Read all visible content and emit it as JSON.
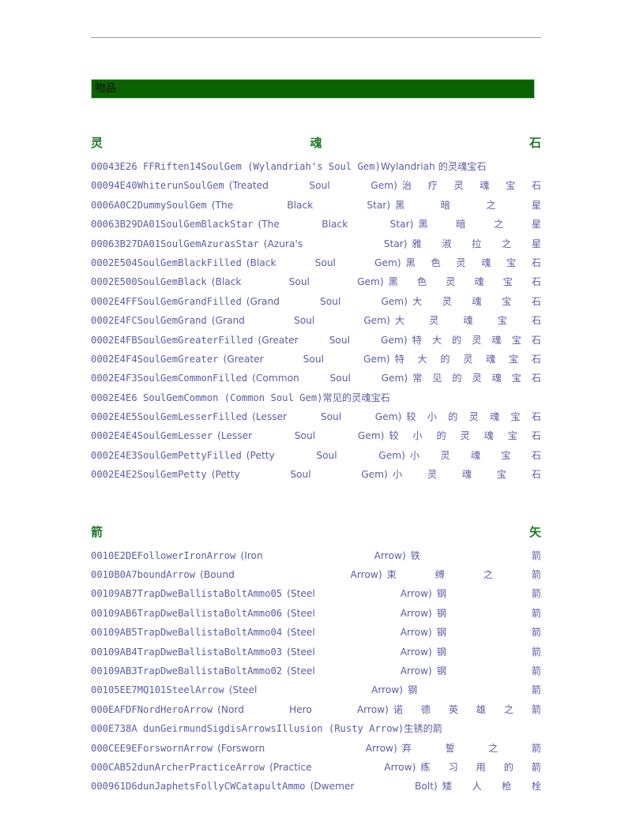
{
  "document": {
    "banner_label": "物品",
    "colors": {
      "banner_bg": "#0a6200",
      "banner_text": "#111111",
      "heading": "#1c7a24",
      "body_text": "#5c5ca8",
      "rule": "#9a9a9a"
    }
  },
  "sections": [
    {
      "heading": "灵魂石",
      "heading_chars": [
        "灵",
        "魂",
        "石"
      ],
      "rows": [
        {
          "id": "00043E26",
          "edid": "FFRiften14SoulGem",
          "en": "(Wylandriah's Soul Gem)",
          "zh": "Wylandriah 的灵魂宝石",
          "justified": false
        },
        {
          "id": "00094E40",
          "edid": "WhiterunSoulGem",
          "en": "(Treated Soul Gem)",
          "zh": "治疗灵魂宝石",
          "justified": true
        },
        {
          "id": "0006A0C2",
          "edid": "DummySoulGem",
          "en": "(The Black Star)",
          "zh": "黑暗之星",
          "justified": true
        },
        {
          "id": "00063B29",
          "edid": "DA01SoulGemBlackStar",
          "en": "(The Black Star)",
          "zh": "黑暗之星",
          "justified": true
        },
        {
          "id": "00063B27",
          "edid": "DA01SoulGemAzurasStar",
          "en": "(Azura's Star)",
          "zh": "雅淑拉之星",
          "justified": true
        },
        {
          "id": "0002E504",
          "edid": "SoulGemBlackFilled",
          "en": "(Black Soul Gem)",
          "zh": "黑色灵魂宝石",
          "justified": true
        },
        {
          "id": "0002E500",
          "edid": "SoulGemBlack",
          "en": "(Black Soul Gem)",
          "zh": "黑色灵魂宝石",
          "justified": true
        },
        {
          "id": "0002E4FF",
          "edid": "SoulGemGrandFilled",
          "en": "(Grand Soul Gem)",
          "zh": "大灵魂宝石",
          "justified": true
        },
        {
          "id": "0002E4FC",
          "edid": "SoulGemGrand",
          "en": "(Grand Soul Gem)",
          "zh": "大灵魂宝石",
          "justified": true
        },
        {
          "id": "0002E4FB",
          "edid": "SoulGemGreaterFilled",
          "en": "(Greater Soul Gem)",
          "zh": "特大的灵魂宝石",
          "justified": true
        },
        {
          "id": "0002E4F4",
          "edid": "SoulGemGreater",
          "en": "(Greater Soul Gem)",
          "zh": "特大的灵魂宝石",
          "justified": true
        },
        {
          "id": "0002E4F3",
          "edid": "SoulGemCommonFilled",
          "en": "(Common Soul Gem)",
          "zh": "常见的灵魂宝石",
          "justified": true
        },
        {
          "id": "0002E4E6",
          "edid": "SoulGemCommon",
          "en": "(Common Soul Gem)",
          "zh": "常见的灵魂宝石",
          "justified": false
        },
        {
          "id": "0002E4E5",
          "edid": "SoulGemLesserFilled",
          "en": "(Lesser Soul Gem)",
          "zh": "较小的灵魂宝石",
          "justified": true
        },
        {
          "id": "0002E4E4",
          "edid": "SoulGemLesser",
          "en": "(Lesser Soul Gem)",
          "zh": "较小的灵魂宝石",
          "justified": true
        },
        {
          "id": "0002E4E3",
          "edid": "SoulGemPettyFilled",
          "en": "(Petty Soul Gem)",
          "zh": "小灵魂宝石",
          "justified": true
        },
        {
          "id": "0002E4E2",
          "edid": "SoulGemPetty",
          "en": "(Petty Soul Gem)",
          "zh": "小灵魂宝石",
          "justified": true
        }
      ]
    },
    {
      "heading": "箭矢",
      "heading_chars": [
        "箭",
        "矢"
      ],
      "rows": [
        {
          "id": "0010E2DE",
          "edid": "FollowerIronArrow",
          "en": "(Iron Arrow)",
          "zh": "铁箭",
          "justified": true
        },
        {
          "id": "0010B0A7",
          "edid": "boundArrow",
          "en": "(Bound Arrow)",
          "zh": "束缚之箭",
          "justified": true
        },
        {
          "id": "00109AB7",
          "edid": "TrapDweBallistaBoltAmmo05",
          "en": "(Steel Arrow)",
          "zh": "钢箭",
          "justified": true
        },
        {
          "id": "00109AB6",
          "edid": "TrapDweBallistaBoltAmmo06",
          "en": "(Steel Arrow)",
          "zh": "钢箭",
          "justified": true
        },
        {
          "id": "00109AB5",
          "edid": "TrapDweBallistaBoltAmmo04",
          "en": "(Steel Arrow)",
          "zh": "钢箭",
          "justified": true
        },
        {
          "id": "00109AB4",
          "edid": "TrapDweBallistaBoltAmmo03",
          "en": "(Steel Arrow)",
          "zh": "钢箭",
          "justified": true
        },
        {
          "id": "00109AB3",
          "edid": "TrapDweBallistaBoltAmmo02",
          "en": "(Steel Arrow)",
          "zh": "钢箭",
          "justified": true
        },
        {
          "id": "00105EE7",
          "edid": "MQ101SteelArrow",
          "en": "(Steel Arrow)",
          "zh": "钢箭",
          "justified": true
        },
        {
          "id": "000EAFDF",
          "edid": "NordHeroArrow",
          "en": "(Nord Hero Arrow)",
          "zh": "诺德英雄之箭",
          "justified": true
        },
        {
          "id": "000E738A",
          "edid": "dunGeirmundSigdisArrowsIllusion",
          "en": "(Rusty Arrow)",
          "zh": "生锈的箭",
          "justified": false
        },
        {
          "id": "000CEE9E",
          "edid": "ForswornArrow",
          "en": "(Forsworn Arrow)",
          "zh": "弃誓之箭",
          "justified": true
        },
        {
          "id": "000CAB52",
          "edid": "dunArcherPracticeArrow",
          "en": "(Practice Arrow)",
          "zh": "练习用的箭",
          "justified": true
        },
        {
          "id": "000961D6",
          "edid": "dunJaphetsFollyCWCatapultAmmo",
          "en": "(Dwemer Bolt)",
          "zh": "矮人枪栓",
          "justified": true
        }
      ]
    }
  ]
}
